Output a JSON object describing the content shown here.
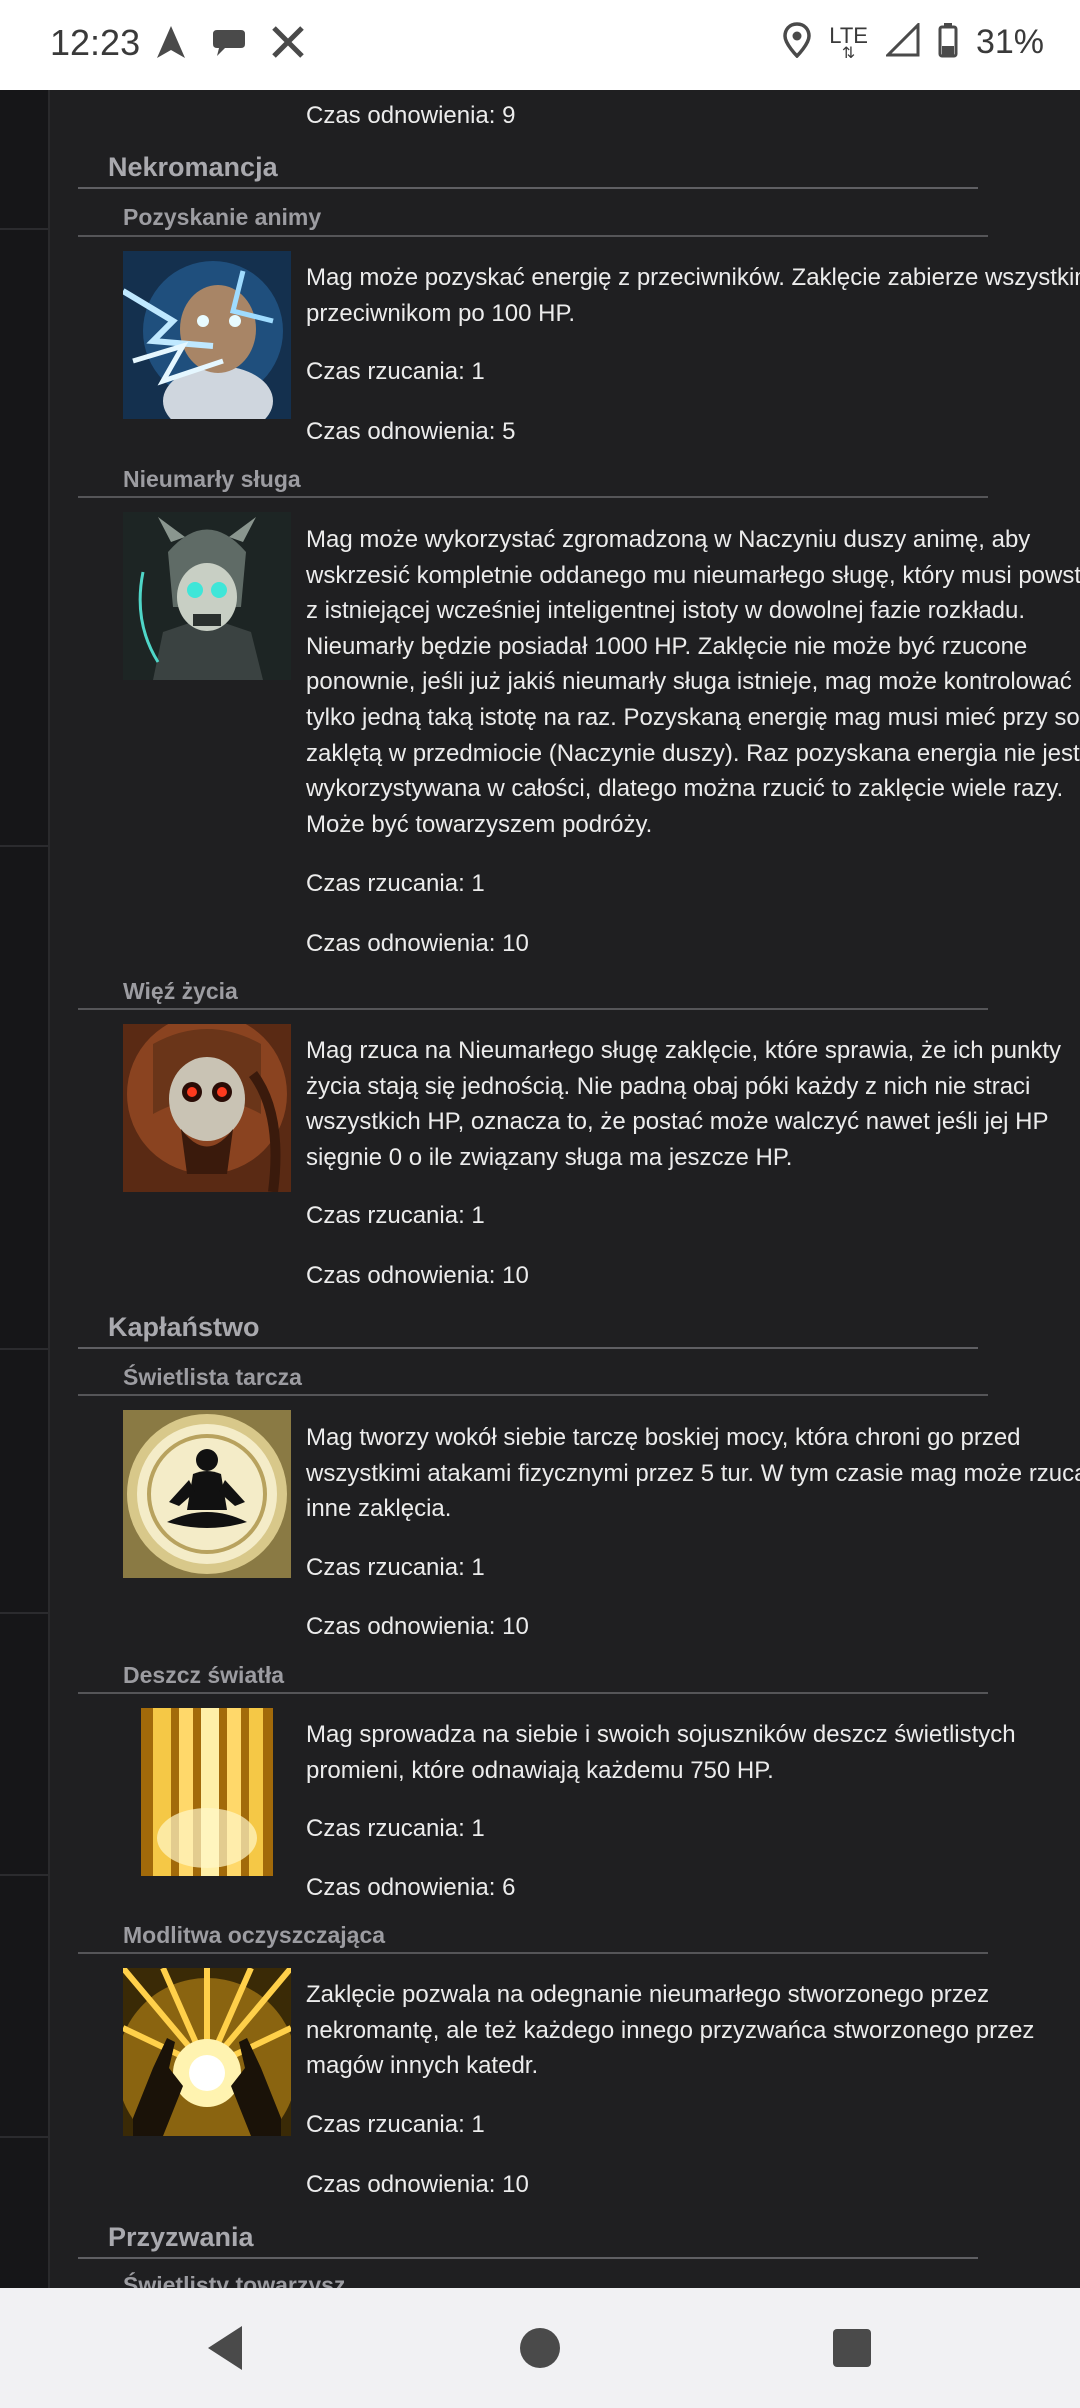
{
  "status_bar": {
    "time": "12:23",
    "network": "LTE",
    "battery": "31%",
    "icons_left": [
      "navigation-icon",
      "chat-icon",
      "x-logo-icon"
    ],
    "icons_right": [
      "location-icon",
      "lte-icon",
      "signal-icon",
      "battery-icon"
    ]
  },
  "content": {
    "top_cooldown": "Czas odnowienia: 9",
    "categories": [
      {
        "name": "Nekromancja",
        "spells": [
          {
            "name": "Pozyskanie animy",
            "icon": "lightning-wizard-icon",
            "description": [
              "Mag może pozyskać energię z przeciwników. Zaklęcie zabierze wszystkim",
              "przeciwnikom po 100 HP."
            ],
            "cast": "Czas rzucania: 1",
            "cooldown": "Czas odnowienia: 5"
          },
          {
            "name": "Nieumarły sługa",
            "icon": "undead-servant-icon",
            "description": [
              "Mag może wykorzystać zgromadzoną w Naczyniu duszy animę, aby",
              "wskrzesić kompletnie oddanego mu nieumarłego sługę, który musi powst",
              "z istniejącej wcześniej inteligentnej istoty w dowolnej fazie rozkładu.",
              "Nieumarły będzie posiadał 1000 HP. Zaklęcie nie może być rzucone",
              "ponownie, jeśli już jakiś nieumarły sługa istnieje, mag może kontrolować",
              "tylko jedną taką istotę na raz. Pozyskaną energię mag musi mieć przy sob",
              "zaklętą w przedmiocie (Naczynie duszy). Raz pozyskana energia nie jest",
              "wykorzystywana w całości, dlatego można rzucić to zaklęcie wiele razy.",
              "Może być towarzyszem podróży."
            ],
            "cast": "Czas rzucania: 1",
            "cooldown": "Czas odnowienia: 10"
          },
          {
            "name": "Więź życia",
            "icon": "skull-bond-icon",
            "description": [
              "Mag rzuca na Nieumarłego sługę zaklęcie, które sprawia, że ich punkty",
              "życia stają się jednością. Nie padną obaj póki każdy z nich nie straci",
              "wszystkich HP, oznacza to, że postać może walczyć nawet jeśli jej HP",
              "sięgnie 0 o ile związany sługa ma jeszcze HP."
            ],
            "cast": "Czas rzucania: 1",
            "cooldown": "Czas odnowienia: 10"
          }
        ]
      },
      {
        "name": "Kapłaństwo",
        "spells": [
          {
            "name": "Świetlista tarcza",
            "icon": "meditation-shield-icon",
            "description": [
              "Mag tworzy wokół siebie tarczę boskiej mocy, która chroni go przed",
              "wszystkimi atakami fizycznymi przez 5 tur. W tym czasie mag może rzuca",
              "inne zaklęcia."
            ],
            "cast": "Czas rzucania: 1",
            "cooldown": "Czas odnowienia: 10"
          },
          {
            "name": "Deszcz światła",
            "icon": "light-rain-icon",
            "description": [
              "Mag sprowadza na siebie i swoich sojuszników deszcz świetlistych",
              "promieni, które odnawiają każdemu 750 HP."
            ],
            "cast": "Czas rzucania: 1",
            "cooldown": "Czas odnowienia: 6"
          },
          {
            "name": "Modlitwa oczyszczająca",
            "icon": "praying-hands-light-icon",
            "description": [
              "Zaklęcie pozwala na odegnanie nieumarłego stworzonego przez",
              "nekromantę, ale też każdego innego przyzwańca stworzonego przez",
              "magów innych katedr."
            ],
            "cast": "Czas rzucania: 1",
            "cooldown": "Czas odnowienia: 10"
          }
        ]
      },
      {
        "name": "Przyzwania",
        "spells": [
          {
            "name": "Świetlisty towarzysz"
          }
        ]
      }
    ]
  },
  "nav_bar": {
    "buttons": [
      "back-icon",
      "home-icon",
      "recents-icon"
    ]
  },
  "colors": {
    "background": "#1f1f21",
    "text": "#ececec",
    "heading": "#a9a9ae",
    "statusbar": "#ffffff",
    "navbar": "#f1f1f3"
  }
}
